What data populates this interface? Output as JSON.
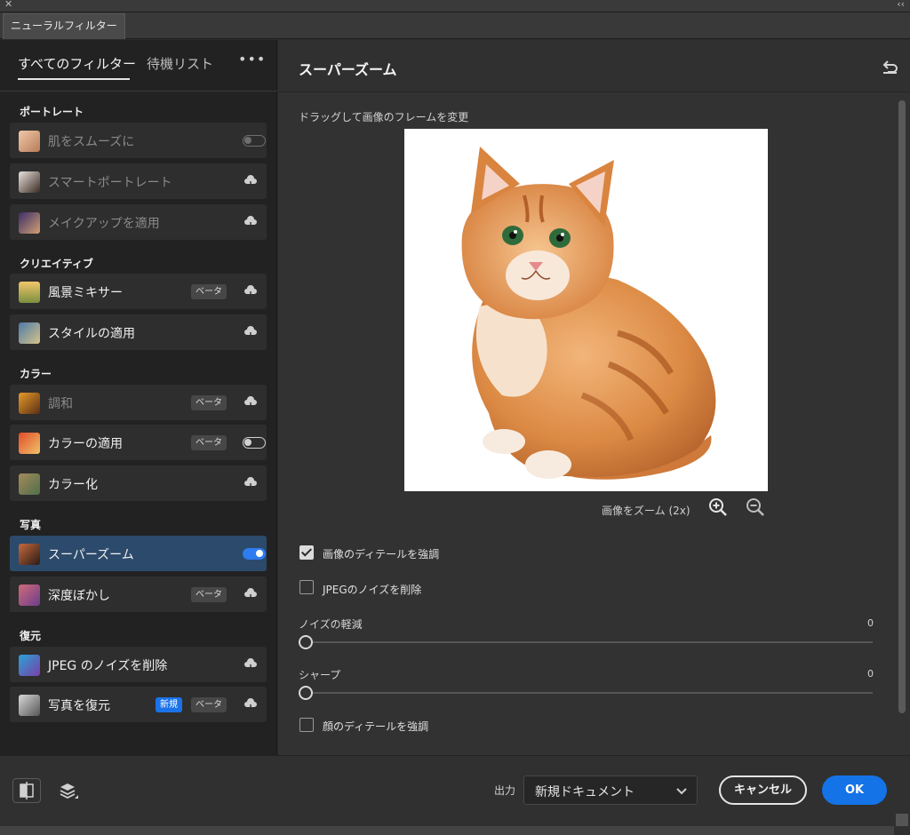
{
  "window": {
    "tab_title": "ニューラルフィルター"
  },
  "left_panel": {
    "tabs": [
      "すべてのフィルター",
      "待機リスト"
    ],
    "more": "•••",
    "sections": {
      "portrait": "ポートレート",
      "creative": "クリエイティブ",
      "color": "カラー",
      "photo": "写真",
      "restore": "復元"
    },
    "filters": {
      "smooth_skin": "肌をスムーズに",
      "smart_portrait": "スマートポートレート",
      "makeup": "メイクアップを適用",
      "landscape_mixer": "風景ミキサー",
      "style_transfer": "スタイルの適用",
      "harmonization": "調和",
      "color_transfer": "カラーの適用",
      "colorize": "カラー化",
      "super_zoom": "スーパーズーム",
      "depth_blur": "深度ぼかし",
      "jpeg_artifacts": "JPEG のノイズを削除",
      "photo_restore": "写真を復元"
    },
    "badges": {
      "beta": "ベータ",
      "new": "新規"
    }
  },
  "right_panel": {
    "title": "スーパーズーム",
    "drag_label": "ドラッグして画像のフレームを変更",
    "zoom_label": "画像をズーム (2x)",
    "options": {
      "enhance_detail": {
        "label": "画像のディテールを強調",
        "checked": true
      },
      "remove_jpeg": {
        "label": "JPEGのノイズを削除",
        "checked": false
      },
      "enhance_face": {
        "label": "顔のディテールを強調",
        "checked": false
      }
    },
    "sliders": {
      "noise": {
        "label": "ノイズの軽減",
        "value": "0"
      },
      "sharpen": {
        "label": "シャープ",
        "value": "0"
      }
    }
  },
  "footer": {
    "output_label": "出力",
    "output_value": "新規ドキュメント",
    "cancel": "キャンセル",
    "ok": "OK"
  },
  "colors": {
    "accent": "#1473e6",
    "selected_row": "#2c4a6b",
    "panel": "#222222"
  }
}
